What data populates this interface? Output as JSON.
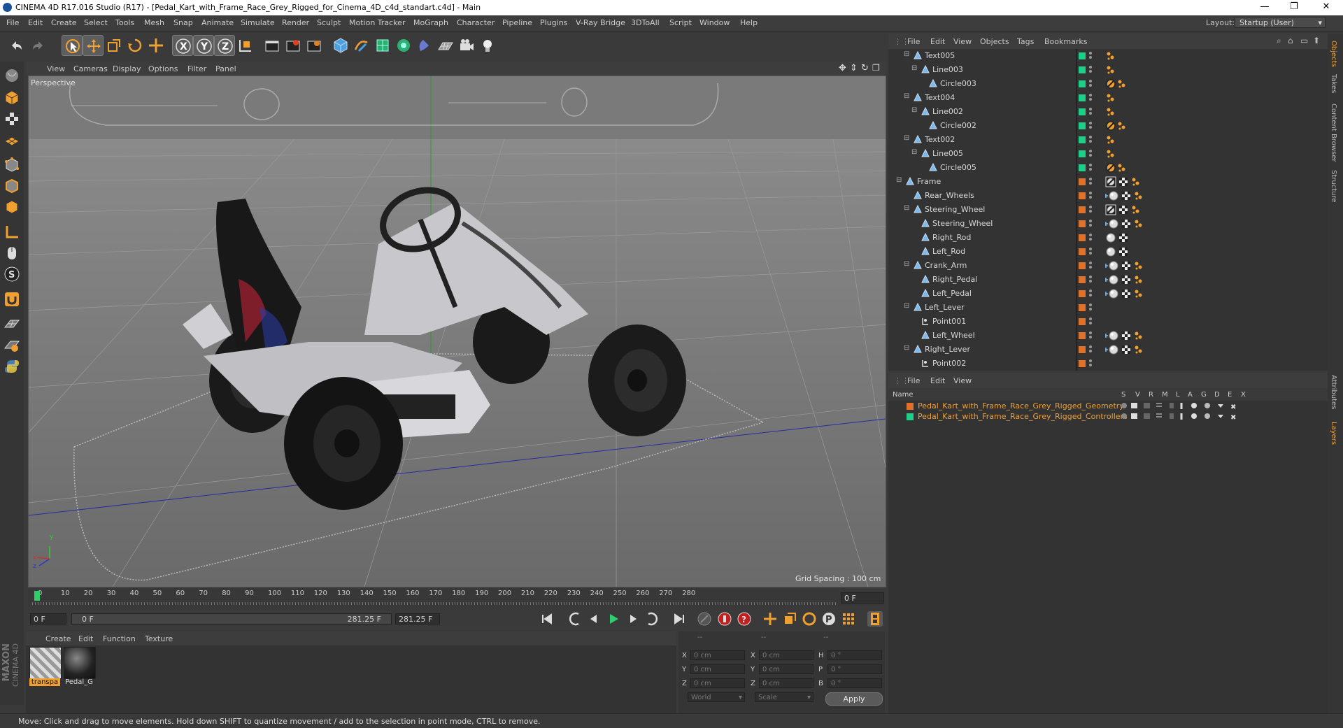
{
  "window": {
    "title": "CINEMA 4D R17.016 Studio (R17) - [Pedal_Kart_with_Frame_Race_Grey_Rigged_for_Cinema_4D_c4d_standart.c4d] - Main",
    "minimize": "—",
    "maximize": "❐",
    "close": "✕"
  },
  "menubar": {
    "items": [
      "File",
      "Edit",
      "Create",
      "Select",
      "Tools",
      "Mesh",
      "Snap",
      "Animate",
      "Simulate",
      "Render",
      "Sculpt",
      "Motion Tracker",
      "MoGraph",
      "Character",
      "Pipeline",
      "Plugins",
      "V-Ray Bridge",
      "3DToAll",
      "Script",
      "Window",
      "Help"
    ],
    "layout_label": "Layout:",
    "layout_value": "Startup (User)"
  },
  "toolbar": {
    "icons": [
      "undo-icon",
      "redo-icon",
      "live-selection-icon",
      "move-icon",
      "scale-icon",
      "rotate-icon",
      "recent-tools-icon",
      "x-axis-lock-icon",
      "y-axis-lock-icon",
      "z-axis-lock-icon",
      "world-coordinates-icon",
      "render-view-icon",
      "render-picture-viewer-icon",
      "edit-render-settings-icon",
      "cube-icon",
      "pen-spline-icon",
      "subdivision-icon",
      "array-icon",
      "deformer-icon",
      "floor-icon",
      "camera-icon",
      "light-icon"
    ]
  },
  "viewport": {
    "menu": [
      "View",
      "Cameras",
      "Display",
      "Options",
      "Filter",
      "Panel"
    ],
    "label": "Perspective",
    "grid_spacing": "Grid Spacing : 100 cm",
    "axis_x": "x",
    "axis_y": "y",
    "axis_z": "z"
  },
  "timeline": {
    "ticks": [
      "0",
      "10",
      "20",
      "30",
      "40",
      "50",
      "60",
      "70",
      "80",
      "90",
      "100",
      "110",
      "120",
      "130",
      "140",
      "150",
      "160",
      "170",
      "180",
      "190",
      "200",
      "210",
      "220",
      "230",
      "240",
      "250",
      "260",
      "270",
      "280"
    ],
    "current_frame": "0 F"
  },
  "playback": {
    "start_field": "0 F",
    "range_start": "0 F",
    "range_end": "281.25 F",
    "end_field": "281.25 F"
  },
  "materials": {
    "menu": [
      "Create",
      "Edit",
      "Function",
      "Texture"
    ],
    "items": [
      {
        "label": "transpa"
      },
      {
        "label": "Pedal_G"
      }
    ]
  },
  "coordinates": {
    "header": [
      "--",
      "--",
      "--"
    ],
    "rows": [
      {
        "l1": "X",
        "v1": "0 cm",
        "l2": "X",
        "v2": "0 cm",
        "l3": "H",
        "v3": "0 °"
      },
      {
        "l1": "Y",
        "v1": "0 cm",
        "l2": "Y",
        "v2": "0 cm",
        "l3": "P",
        "v3": "0 °"
      },
      {
        "l1": "Z",
        "v1": "0 cm",
        "l2": "Z",
        "v2": "0 cm",
        "l3": "B",
        "v3": "0 °"
      }
    ],
    "mode": "World",
    "transform": "Scale",
    "apply": "Apply"
  },
  "status": {
    "text": "Move: Click and drag to move elements. Hold down SHIFT to quantize movement / add to the selection in point mode, CTRL to remove."
  },
  "object_manager": {
    "menu": [
      "File",
      "Edit",
      "View",
      "Objects",
      "Tags",
      "Bookmarks"
    ],
    "rows": [
      {
        "name": "Text005",
        "depth": 2,
        "color": "#1ecf8a",
        "tags": "text"
      },
      {
        "name": "Line003",
        "depth": 3,
        "color": "#1ecf8a",
        "tags": "text"
      },
      {
        "name": "Circle003",
        "depth": 4,
        "color": "#1ecf8a",
        "tags": "circle"
      },
      {
        "name": "Text004",
        "depth": 2,
        "color": "#1ecf8a",
        "tags": "text"
      },
      {
        "name": "Line002",
        "depth": 3,
        "color": "#1ecf8a",
        "tags": "text"
      },
      {
        "name": "Circle002",
        "depth": 4,
        "color": "#1ecf8a",
        "tags": "circle"
      },
      {
        "name": "Text002",
        "depth": 2,
        "color": "#1ecf8a",
        "tags": "text"
      },
      {
        "name": "Line005",
        "depth": 3,
        "color": "#1ecf8a",
        "tags": "text"
      },
      {
        "name": "Circle005",
        "depth": 4,
        "color": "#1ecf8a",
        "tags": "circle"
      },
      {
        "name": "Frame",
        "depth": 1,
        "color": "#e0702a",
        "tags": "full"
      },
      {
        "name": "Rear_Wheels",
        "depth": 2,
        "color": "#e0702a",
        "tags": "full2"
      },
      {
        "name": "Steering_Wheel",
        "depth": 2,
        "color": "#e0702a",
        "tags": "full"
      },
      {
        "name": "Steering_Wheel",
        "depth": 3,
        "color": "#e0702a",
        "tags": "full2"
      },
      {
        "name": "Right_Rod",
        "depth": 3,
        "color": "#e0702a",
        "tags": "sphere"
      },
      {
        "name": "Left_Rod",
        "depth": 3,
        "color": "#e0702a",
        "tags": "sphere"
      },
      {
        "name": "Crank_Arm",
        "depth": 2,
        "color": "#e0702a",
        "tags": "full2"
      },
      {
        "name": "Right_Pedal",
        "depth": 3,
        "color": "#e0702a",
        "tags": "full2"
      },
      {
        "name": "Left_Pedal",
        "depth": 3,
        "color": "#e0702a",
        "tags": "full2"
      },
      {
        "name": "Left_Lever",
        "depth": 2,
        "color": "#e0702a",
        "tags": "none"
      },
      {
        "name": "Point001",
        "depth": 3,
        "color": "#e0702a",
        "tags": "none"
      },
      {
        "name": "Left_Wheel",
        "depth": 3,
        "color": "#e0702a",
        "tags": "full2"
      },
      {
        "name": "Right_Lever",
        "depth": 2,
        "color": "#e0702a",
        "tags": "full2"
      },
      {
        "name": "Point002",
        "depth": 3,
        "color": "#e0702a",
        "tags": "none"
      }
    ]
  },
  "layer_manager": {
    "menu": [
      "File",
      "Edit",
      "View"
    ],
    "columns": [
      "Name",
      "S",
      "V",
      "R",
      "M",
      "L",
      "A",
      "G",
      "D",
      "E",
      "X"
    ],
    "rows": [
      {
        "name": "Pedal_Kart_with_Frame_Race_Grey_Rigged_Geometry",
        "color": "#e0702a"
      },
      {
        "name": "Pedal_Kart_with_Frame_Race_Grey_Rigged_Controllers",
        "color": "#1ecf8a"
      }
    ]
  },
  "right_tabs": [
    "Objects",
    "Takes",
    "Content Browser",
    "Structure",
    "Attributes",
    "Layers"
  ],
  "branding": {
    "line1": "MAXON",
    "line2": "CINEMA 4D"
  },
  "colors": {
    "accent": "#f0a030",
    "green": "#1ecf8a",
    "orange": "#e0702a"
  }
}
